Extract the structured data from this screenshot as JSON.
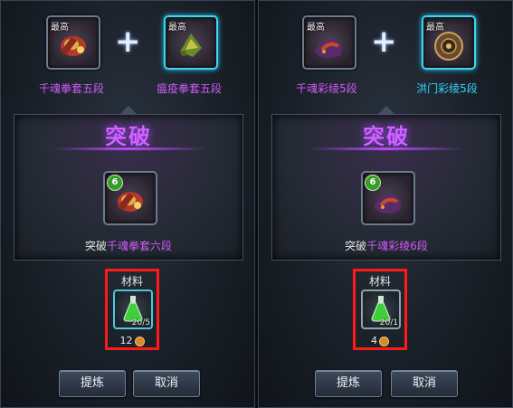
{
  "panels": [
    {
      "slot_a_tag": "最高",
      "slot_b_tag": "最高",
      "item_a_name": "千魂拳套五段",
      "item_b_name": "瘟疫拳套五段",
      "plus": "+",
      "break_title": "突破",
      "result_level": "6",
      "result_prefix": "突破",
      "result_name": "千魂拳套六段",
      "material_label": "材料",
      "material_count": "20/5",
      "cost_amount": "12",
      "refine_button": "提炼",
      "cancel_button": "取消"
    },
    {
      "slot_a_tag": "最高",
      "slot_b_tag": "最高",
      "item_a_name": "千魂彩绫5段",
      "item_b_name": "洪门彩绫5段",
      "plus": "+",
      "break_title": "突破",
      "result_level": "6",
      "result_prefix": "突破",
      "result_name": "千魂彩绫6段",
      "material_label": "材料",
      "material_count": "20/1",
      "cost_amount": "4",
      "refine_button": "提炼",
      "cancel_button": "取消"
    }
  ],
  "colors": {
    "purple_text": "#d35bff",
    "cyan_text": "#31d8ff",
    "highlight_border": "#ff1a1a"
  }
}
